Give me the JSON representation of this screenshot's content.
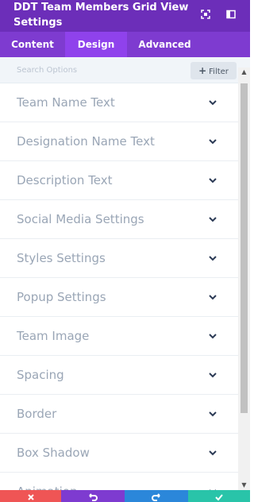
{
  "header": {
    "title": "DDT Team Members Grid View Settings",
    "icons": [
      "expand-icon",
      "sidebar-toggle-icon"
    ]
  },
  "tabs": [
    {
      "label": "Content",
      "active": false
    },
    {
      "label": "Design",
      "active": true
    },
    {
      "label": "Advanced",
      "active": false
    }
  ],
  "search": {
    "placeholder": "Search Options",
    "filter_label": "Filter"
  },
  "sections": [
    {
      "label": "Team Name Text"
    },
    {
      "label": "Designation Name Text"
    },
    {
      "label": "Description Text"
    },
    {
      "label": "Social Media Settings"
    },
    {
      "label": "Styles Settings"
    },
    {
      "label": "Popup Settings"
    },
    {
      "label": "Team Image"
    },
    {
      "label": "Spacing"
    },
    {
      "label": "Border"
    },
    {
      "label": "Box Shadow"
    },
    {
      "label": "Animation"
    }
  ],
  "footer": {
    "buttons": [
      {
        "action": "discard",
        "icon": "close-icon",
        "color": "#ef5555"
      },
      {
        "action": "undo",
        "icon": "undo-icon",
        "color": "#7e3bd0"
      },
      {
        "action": "redo",
        "icon": "redo-icon",
        "color": "#2b87da"
      },
      {
        "action": "save",
        "icon": "check-icon",
        "color": "#29c4a9"
      }
    ]
  },
  "colors": {
    "header_bg": "#6c2eb9",
    "tabs_bg": "#7e3bd0",
    "active_tab_bg": "#8f42ec",
    "section_text": "#9aa6b6",
    "chevron": "#2b3a55"
  }
}
